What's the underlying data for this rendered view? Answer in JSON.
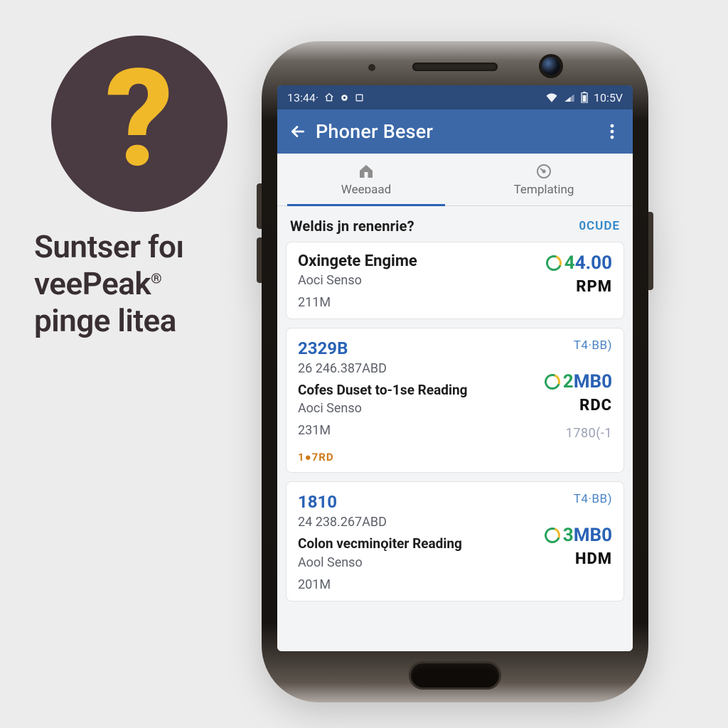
{
  "promo": {
    "line1": "Suntser foı",
    "line2_a": "veePeak",
    "line2_reg": "®",
    "line3": "pinge litea"
  },
  "status_bar": {
    "time_left": "13:44·",
    "time_right": "10:5V"
  },
  "app_bar": {
    "title": "Phoner Beser"
  },
  "tabs": [
    {
      "label": "Weeɒaad"
    },
    {
      "label": "Templating"
    }
  ],
  "section": {
    "question": "Weldis jn renenrie?",
    "link": "0CUDE"
  },
  "cards": [
    {
      "left": {
        "title": "Oxingete Engime",
        "sub1": "Aoci Senso",
        "sub2": "211M"
      },
      "right": {
        "value_lead": "4",
        "value_rest": "4.00",
        "unit": "RPM"
      }
    },
    {
      "left": {
        "code": "2329B",
        "sub1": "26 246.387ABD",
        "bold": "Cofes Duset to-1se Reading",
        "sub2": "Aoci Senso",
        "sub3": "231M",
        "tag": "1●7RD"
      },
      "right": {
        "badge": "T4·BB)",
        "value_lead": "2",
        "value_rest": "MB0",
        "unit": "RDC",
        "faint": "1780(-1"
      }
    },
    {
      "left": {
        "code": "1810",
        "sub1": "24 238.267ABD",
        "bold": "Colon vecminǫiter Reading",
        "sub2": "Aool Senso",
        "sub3": "201M"
      },
      "right": {
        "badge": "T4·BB)",
        "value_lead": "3",
        "value_rest": "MB0",
        "unit": "HDM"
      }
    }
  ]
}
